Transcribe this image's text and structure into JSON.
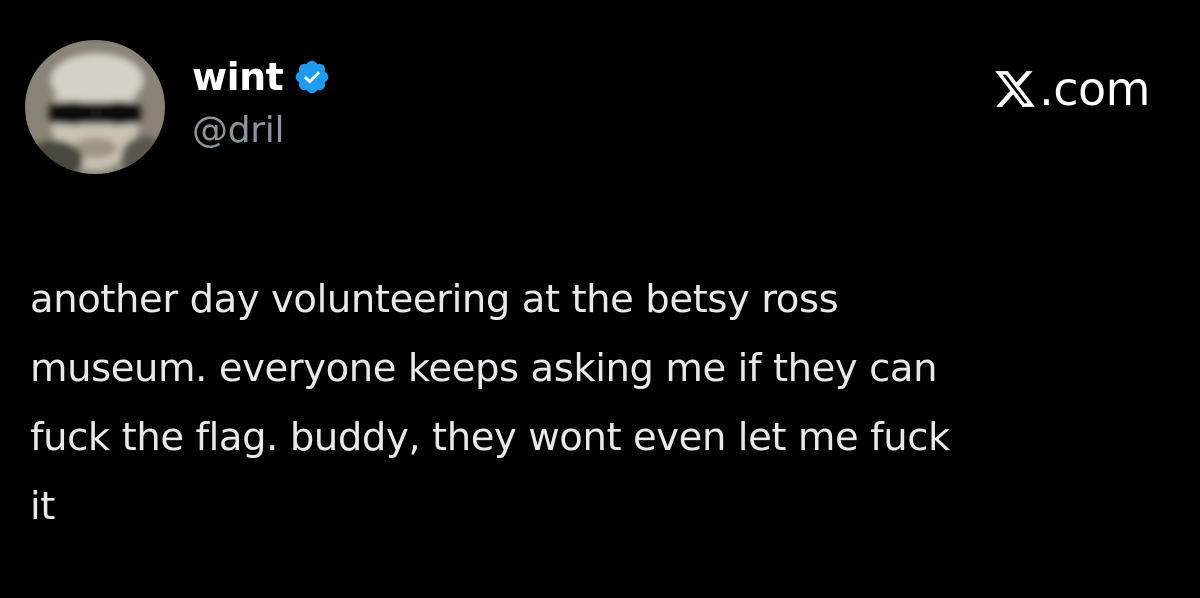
{
  "author": {
    "display_name": "wint",
    "handle": "@dril",
    "verified": true,
    "verified_color": "#1d9bf0",
    "avatar_icon": "blurred-profile-photo"
  },
  "site": {
    "logo_icon": "x-logo-icon",
    "domain_suffix": ".com"
  },
  "tweet": {
    "text": "another day volunteering at the betsy ross\nmuseum. everyone keeps asking me if they can\nfuck the flag. buddy, they wont even let me fuck\nit"
  },
  "colors": {
    "background": "#000000",
    "text_primary": "#e7e9ea",
    "text_secondary": "#8b949c"
  }
}
